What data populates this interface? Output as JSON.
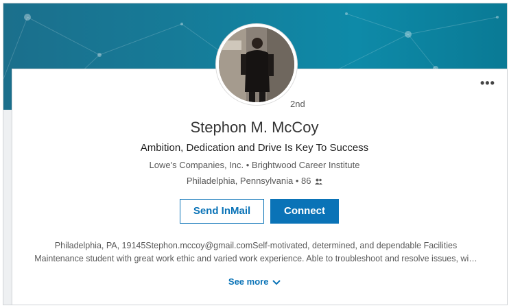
{
  "profile": {
    "degree": "2nd",
    "name": "Stephon M. McCoy",
    "headline": "Ambition, Dedication and Drive Is Key To Success",
    "companies": "Lowe's Companies, Inc. • Brightwood Career Institute",
    "location": "Philadelphia, Pennsylvania • 86",
    "connections_icon": "people-icon",
    "summary_line1": "Philadelphia, PA, 19145Stephon.mccoy@gmail.comSelf-motivated, determined, and dependable Facilities",
    "summary_line2": "Maintenance student with great work ethic and varied work experience. Able to troubleshoot and resolve issues, wi…"
  },
  "actions": {
    "more_label": "•••",
    "send_inmail": "Send InMail",
    "connect": "Connect",
    "see_more": "See more"
  },
  "colors": {
    "brand_blue": "#0a73b7",
    "banner_teal": "#167b98"
  }
}
